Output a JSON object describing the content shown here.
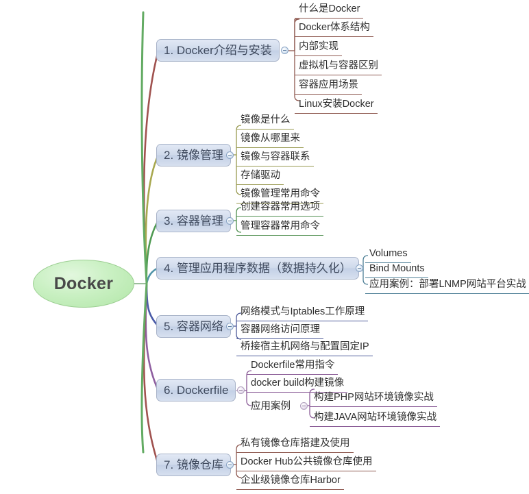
{
  "title": "Docker 思维导图",
  "root": {
    "label": "Docker",
    "color": "#b2e6a8"
  },
  "colors": {
    "branch_fill": "#cfdaeb",
    "branch_border": "#a9b4c9",
    "branch_text": "#3f4a5e",
    "root_fill": "#b2e6a8",
    "root_text": "#494949",
    "leaf_text": "#2e2e2e",
    "wire_1": "#a0524f",
    "wire_2": "#a8a84f",
    "wire_3": "#4f9a52",
    "wire_4": "#4f93a8",
    "wire_5": "#4a5ba8",
    "wire_6": "#8f5fa0",
    "wire_7": "#a0524f"
  },
  "branches": [
    {
      "index": 1,
      "label": "1. Docker介绍与安装",
      "wire_color": "#a0524f",
      "toggle": "collapse-toggle",
      "leaves": [
        "什么是Docker",
        "Docker体系结构",
        "内部实现",
        "虚拟机与容器区别",
        "容器应用场景",
        "Linux安装Docker"
      ]
    },
    {
      "index": 2,
      "label": "2. 镜像管理",
      "wire_color": "#a8a84f",
      "toggle": "collapse-toggle",
      "leaves": [
        "镜像是什么",
        "镜像从哪里来",
        "镜像与容器联系",
        "存储驱动",
        "镜像管理常用命令"
      ]
    },
    {
      "index": 3,
      "label": "3. 容器管理",
      "wire_color": "#4f9a52",
      "toggle": "collapse-toggle",
      "leaves": [
        "创建容器常用选项",
        "管理容器常用命令"
      ]
    },
    {
      "index": 4,
      "label": "4. 管理应用程序数据（数据持久化）",
      "wire_color": "#4f93a8",
      "toggle": "collapse-toggle",
      "leaves": [
        "Volumes",
        "Bind Mounts",
        "应用案例：部署LNMP网站平台实战"
      ]
    },
    {
      "index": 5,
      "label": "5. 容器网络",
      "wire_color": "#4a5ba8",
      "toggle": "collapse-toggle",
      "leaves": [
        "网络模式与Iptables工作原理",
        "容器网络访问原理",
        "桥接宿主机网络与配置固定IP"
      ]
    },
    {
      "index": 6,
      "label": "6. Dockerfile",
      "wire_color": "#8f5fa0",
      "toggle": "collapse-toggle",
      "leaves": [
        "Dockerfile常用指令",
        "docker build构建镜像"
      ],
      "subbranch": {
        "label": "应用案例",
        "toggle": "collapse-toggle",
        "leaves": [
          "构建PHP网站环境镜像实战",
          "构建JAVA网站环境镜像实战"
        ]
      }
    },
    {
      "index": 7,
      "label": "7. 镜像仓库",
      "wire_color": "#a0524f",
      "toggle": "collapse-toggle",
      "leaves": [
        "私有镜像仓库搭建及使用",
        "Docker Hub公共镜像仓库使用",
        "企业级镜像仓库Harbor"
      ]
    }
  ]
}
